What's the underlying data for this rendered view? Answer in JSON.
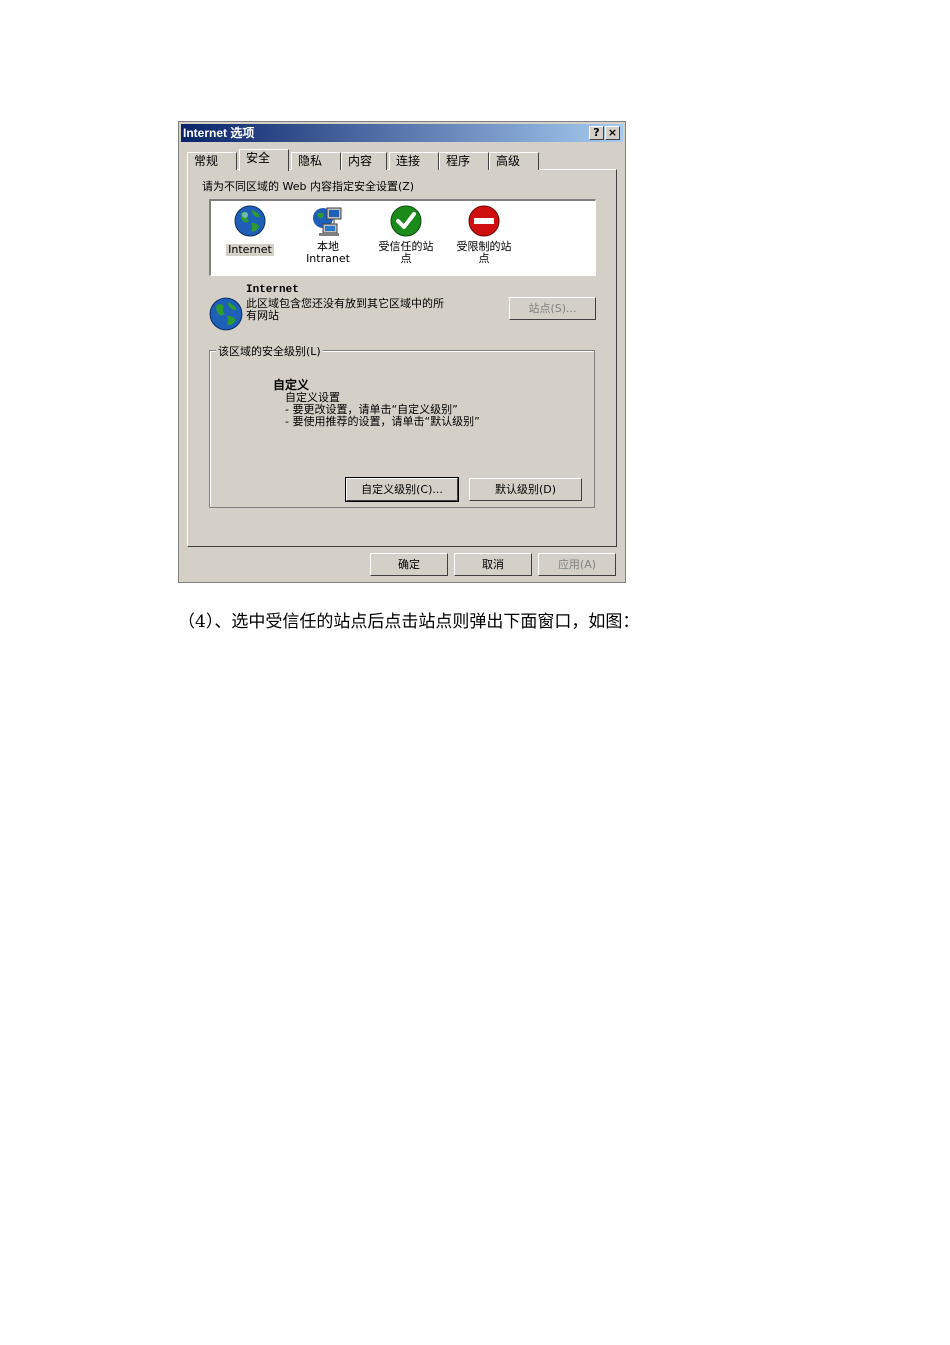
{
  "dialog": {
    "title": "Internet 选项",
    "help_label": "?",
    "close_label": "×",
    "tabs": [
      {
        "label": "常规"
      },
      {
        "label": "安全"
      },
      {
        "label": "隐私"
      },
      {
        "label": "内容"
      },
      {
        "label": "连接"
      },
      {
        "label": "程序"
      },
      {
        "label": "高级"
      }
    ],
    "active_tab": "安全",
    "zone_prompt": "请为不同区域的 Web 内容指定安全设置(Z)",
    "zones": [
      {
        "label": "Internet",
        "icon": "globe-icon"
      },
      {
        "label": "本地\nIntranet",
        "icon": "network-computer-icon"
      },
      {
        "label": "受信任的站\n点",
        "icon": "green-check-icon"
      },
      {
        "label": "受限制的站\n点",
        "icon": "red-no-entry-icon"
      }
    ],
    "selected_zone": "Internet",
    "zone_name": "Internet",
    "zone_description": "此区域包含您还没有放到其它区域中的所有网站",
    "sites_button": "站点(S)...",
    "security_level_group": "该区域的安全级别(L)",
    "level_title": "自定义",
    "level_lines": [
      "自定义设置",
      "- 要更改设置，请单击“自定义级别”",
      "- 要使用推荐的设置，请单击“默认级别”"
    ],
    "custom_level_button": "自定义级别(C)...",
    "default_level_button": "默认级别(D)",
    "ok_button": "确定",
    "cancel_button": "取消",
    "apply_button": "应用(A)",
    "colors": {
      "titlebar": "#0a246a",
      "face": "#d4d0c8",
      "check_green": "#1a8a1a",
      "restricted_red": "#d01010"
    }
  },
  "caption": "（4）、选中受信任的站点后点击站点则弹出下面窗口，如图："
}
